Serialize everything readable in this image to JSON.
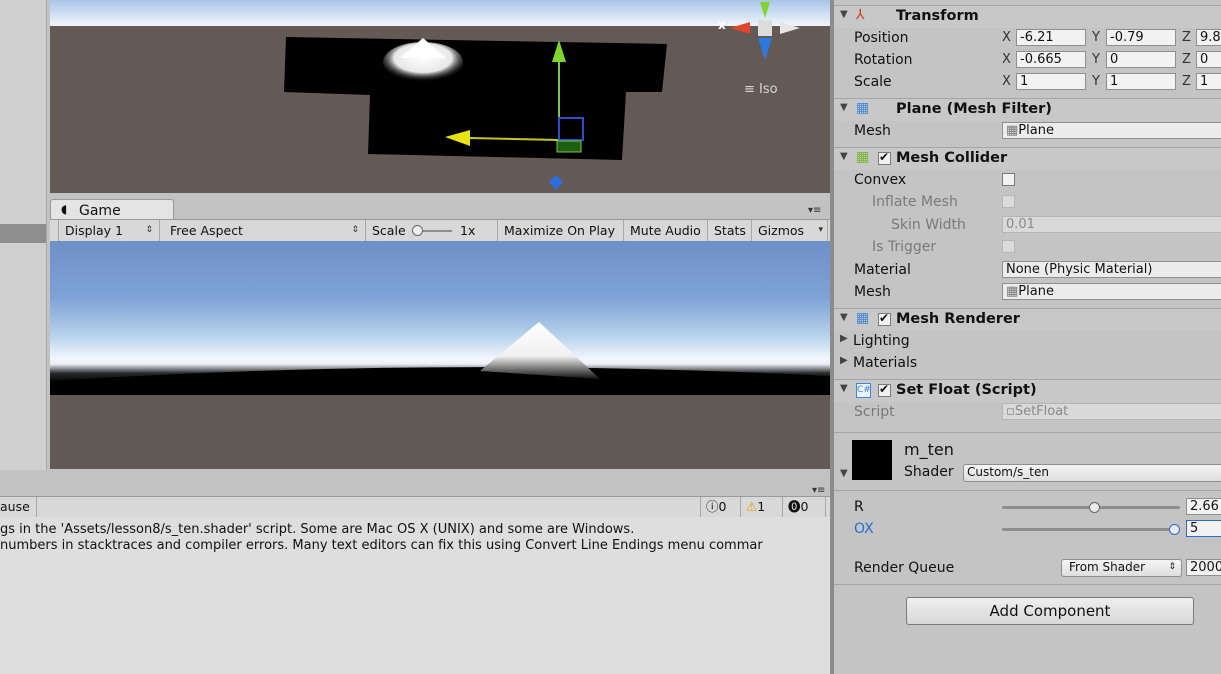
{
  "scene": {
    "iso_label": "Iso",
    "gizmo_x_label": "x"
  },
  "game_tab": {
    "label": "Game",
    "toolbar": {
      "display": "Display 1",
      "aspect": "Free Aspect",
      "scale_label": "Scale",
      "scale_value": "1x",
      "maximize": "Maximize On Play",
      "mute": "Mute Audio",
      "stats": "Stats",
      "gizmos": "Gizmos"
    }
  },
  "console": {
    "pause_label": "ause",
    "errors_count": "0",
    "warnings_count": "1",
    "messages_count": "0",
    "lines": [
      "gs in the 'Assets/lesson8/s_ten.shader' script. Some are Mac OS X (UNIX) and some are Windows.",
      "numbers in stacktraces and compiler errors. Many text editors can fix this using Convert Line Endings menu commar"
    ]
  },
  "inspector": {
    "transform": {
      "title": "Transform",
      "position": {
        "label": "Position",
        "x": "-6.21",
        "y": "-0.79",
        "z": "9.8"
      },
      "rotation": {
        "label": "Rotation",
        "x": "-0.665",
        "y": "0",
        "z": "0"
      },
      "scale": {
        "label": "Scale",
        "x": "1",
        "y": "1",
        "z": "1"
      }
    },
    "mesh_filter": {
      "title": "Plane (Mesh Filter)",
      "mesh_label": "Mesh",
      "mesh_value": "Plane"
    },
    "mesh_collider": {
      "title": "Mesh Collider",
      "convex": "Convex",
      "inflate_mesh": "Inflate Mesh",
      "skin_width": "Skin Width",
      "skin_width_value": "0.01",
      "is_trigger": "Is Trigger",
      "material_label": "Material",
      "material_value": "None (Physic Material)",
      "mesh_label": "Mesh",
      "mesh_value": "Plane"
    },
    "mesh_renderer": {
      "title": "Mesh Renderer",
      "lighting": "Lighting",
      "materials": "Materials"
    },
    "set_float": {
      "title": "Set Float (Script)",
      "script_label": "Script",
      "script_value": "SetFloat"
    },
    "material": {
      "name": "m_ten",
      "shader_label": "Shader",
      "shader_value": "Custom/s_ten",
      "r_label": "R",
      "r_value": "2.66",
      "r_fraction": 0.52,
      "ox_label": "OX",
      "ox_value": "5",
      "ox_fraction": 1.0,
      "render_queue_label": "Render Queue",
      "render_queue_mode": "From Shader",
      "render_queue_value": "2000"
    },
    "add_component": "Add Component"
  },
  "colors": {
    "scene_ground": "#635a55",
    "ox_label": "#2d6bd0",
    "inspector_bg": "#c4c4c4"
  }
}
